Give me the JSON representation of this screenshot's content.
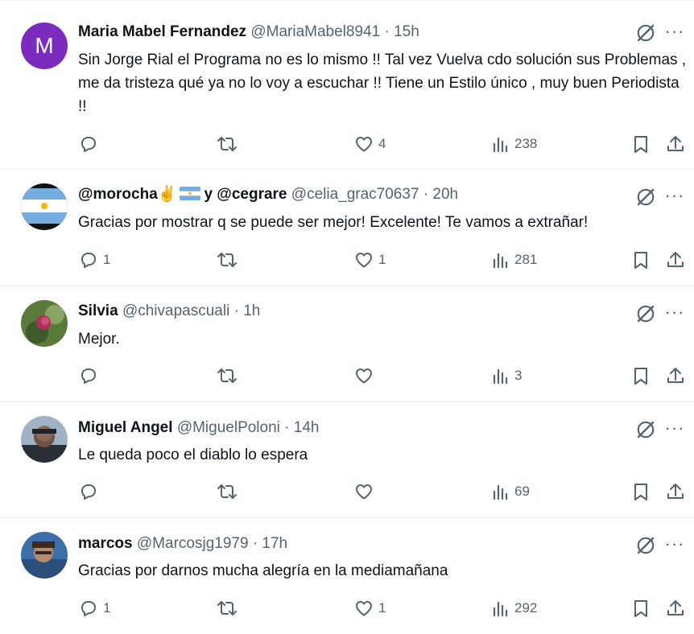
{
  "replies": [
    {
      "name": "Maria Mabel Fernandez",
      "handle": "@MariaMabel8941",
      "sep": "·",
      "time": "15h",
      "text": "Sin Jorge Rial el Programa no es lo mismo !! Tal vez Vuelva  cdo solución sus Problemas , me da tristeza qué ya no lo voy a escuchar !! Tiene un Estilo único , muy buen Periodista !!",
      "avatar_letter": "M",
      "avatar_color": "#7b2cbf",
      "replies": "",
      "retweets": "",
      "likes": "4",
      "views": "238"
    },
    {
      "name_part1": "@morocha",
      "name_part2": "y @cegrare",
      "emoji": "✌",
      "handle": "@celia_grac70637",
      "sep": "·",
      "time": "20h",
      "text": "Gracias por mostrar q se puede ser mejor! Excelente! Te vamos a extrañar!",
      "replies": "1",
      "retweets": "",
      "likes": "1",
      "views": "281"
    },
    {
      "name": "Silvia",
      "handle": "@chivapascuali",
      "sep": "·",
      "time": "1h",
      "text": "Mejor.",
      "replies": "",
      "retweets": "",
      "likes": "",
      "views": "3"
    },
    {
      "name": "Miguel Angel",
      "handle": "@MiguelPoloni",
      "sep": "·",
      "time": "14h",
      "text": "Le queda poco el diablo lo espera",
      "replies": "",
      "retweets": "",
      "likes": "",
      "views": "69"
    },
    {
      "name": "marcos",
      "handle": "@Marcosjg1979",
      "sep": "·",
      "time": "17h",
      "text": "Gracias por darnos mucha alegría en la mediamañana",
      "replies": "1",
      "retweets": "",
      "likes": "1",
      "views": "292"
    }
  ],
  "icons": {
    "reply": "reply-icon",
    "retweet": "retweet-icon",
    "like": "heart-icon",
    "views": "views-icon",
    "bookmark": "bookmark-icon",
    "share": "share-icon",
    "grok": "grok-icon",
    "more": "more-icon"
  },
  "colors": {
    "text": "#0f1419",
    "secondary": "#536471",
    "divider": "#eff3f4"
  },
  "more_glyph": "···"
}
